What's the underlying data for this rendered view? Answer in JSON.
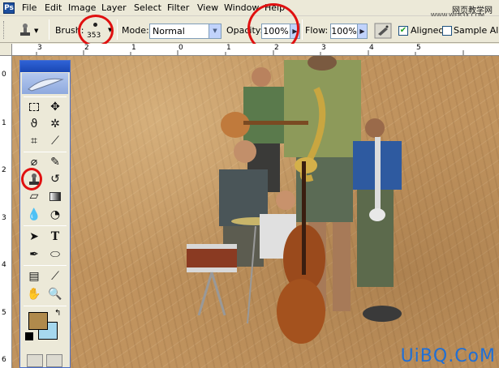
{
  "menubar": {
    "app_icon": "Ps",
    "items": [
      "File",
      "Edit",
      "Image",
      "Layer",
      "Select",
      "Filter",
      "View",
      "Window",
      "Help"
    ],
    "watermark": "网页教学网",
    "watermark_small": "WWW.WEB3X.COM"
  },
  "options": {
    "brush_label": "Brush:",
    "brush_size": "353",
    "mode_label": "Mode:",
    "mode_value": "Normal",
    "opacity_label": "Opacity:",
    "opacity_value": "100%",
    "flow_label": "Flow:",
    "flow_value": "100%",
    "aligned_label": "Aligned",
    "aligned_checked": true,
    "sample_label": "Sample All La"
  },
  "rulers": {
    "horizontal": [
      "3",
      "2",
      "1",
      "0",
      "1",
      "2",
      "3",
      "4",
      "5"
    ],
    "vertical": [
      "0",
      "1",
      "2",
      "3",
      "4",
      "5",
      "6"
    ]
  },
  "colors": {
    "foreground": "#b08a4c",
    "background": "#a6d8ee",
    "highlight_circle": "#e01010"
  },
  "canvas": {
    "watermark": "UiBQ.CoM"
  },
  "toolbox": {
    "tools": [
      [
        "marquee-icon",
        "move-icon"
      ],
      [
        "lasso-icon",
        "magic-wand-icon"
      ],
      [
        "crop-icon",
        "slice-icon"
      ],
      [
        "healing-brush-icon",
        "brush-icon"
      ],
      [
        "clone-stamp-icon",
        "history-brush-icon"
      ],
      [
        "eraser-icon",
        "gradient-icon"
      ],
      [
        "blur-icon",
        "dodge-icon"
      ],
      [
        "path-select-icon",
        "type-icon"
      ],
      [
        "pen-icon",
        "shape-icon"
      ],
      [
        "notes-icon",
        "eyedropper-icon"
      ],
      [
        "hand-icon",
        "zoom-icon"
      ]
    ]
  }
}
